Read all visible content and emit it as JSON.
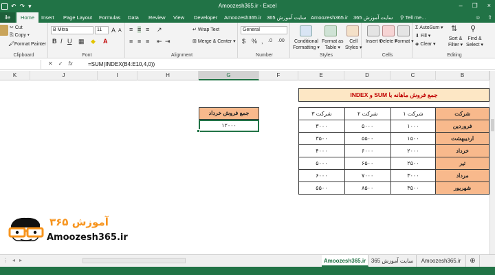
{
  "window": {
    "title": "Amoozesh365.ir - Excel",
    "controls": [
      "–",
      "❐",
      "×"
    ]
  },
  "qat": {
    "undo": "↶",
    "redo": "↷"
  },
  "tabs": {
    "file": "ile",
    "items": [
      "Home",
      "Insert",
      "Page Layout",
      "Formulas",
      "Data",
      "Review",
      "View",
      "Developer",
      "Amoozesh365.ir",
      "سایت آموزش 365",
      "Amoozesh365.ir",
      "سایت آموزش 365"
    ],
    "tell_me": "Tell me..."
  },
  "ribbon": {
    "clipboard": {
      "label": "Clipboard",
      "cut": "Cut",
      "copy": "Copy",
      "format_painter": "Format Painter"
    },
    "font": {
      "label": "Font",
      "family": "B Mitra",
      "size": "11"
    },
    "alignment": {
      "label": "Alignment",
      "wrap": "Wrap Text",
      "merge": "Merge & Center"
    },
    "number": {
      "label": "Number",
      "format": "General"
    },
    "styles": {
      "label": "Styles",
      "conditional": "Conditional",
      "conditional2": "Formatting",
      "format_table": "Format as",
      "format_table2": "Table",
      "cell_styles": "Cell",
      "cell_styles2": "Styles"
    },
    "cells": {
      "label": "Cells",
      "insert": "Insert",
      "delete": "Delete",
      "format": "Format"
    },
    "editing": {
      "label": "Editing",
      "autosum": "AutoSum",
      "fill": "Fill",
      "clear": "Clear",
      "sort": "Sort &",
      "sort2": "Filter",
      "find": "Find &",
      "find2": "Select"
    }
  },
  "formula_bar": {
    "formula": "=SUM(INDEX(B4:E10,4,0))"
  },
  "columns": [
    "K",
    "J",
    "I",
    "H",
    "G",
    "F",
    "E",
    "D",
    "C",
    "B"
  ],
  "selected_column": "G",
  "sheet": {
    "title": "جمع فروش ماهانه با SUM و INDEX",
    "headers": [
      "شرکت",
      "شرکت ۱",
      "شرکت ۲",
      "شرکت ۳"
    ],
    "rows": [
      [
        "فروردین",
        "۱۰۰۰",
        "۵۰۰۰",
        "۳۰۰۰"
      ],
      [
        "اردیبهشت",
        "۱۵۰۰",
        "۵۵۰۰",
        "۳۵۰۰"
      ],
      [
        "خرداد",
        "۲۰۰۰",
        "۶۰۰۰",
        "۴۰۰۰"
      ],
      [
        "تیر",
        "۲۵۰۰",
        "۶۵۰۰",
        "۵۰۰۰"
      ],
      [
        "مرداد",
        "۳۰۰۰",
        "۷۰۰۰",
        "۶۰۰۰"
      ],
      [
        "شهریور",
        "۳۵۰۰",
        "۸۵۰۰",
        "۵۵۰۰"
      ]
    ],
    "total_label": "جمع فروش خرداد",
    "total_value": "۱۲۰۰۰"
  },
  "logo": {
    "brand": "آموزش ۳۶۵",
    "domain": "Amoozesh365.ir"
  },
  "sheet_tabs": [
    "Amoozesh365.ir",
    "سایت آموزش 365",
    "Amoozesh365.ir"
  ],
  "active_sheet_tab": 0
}
